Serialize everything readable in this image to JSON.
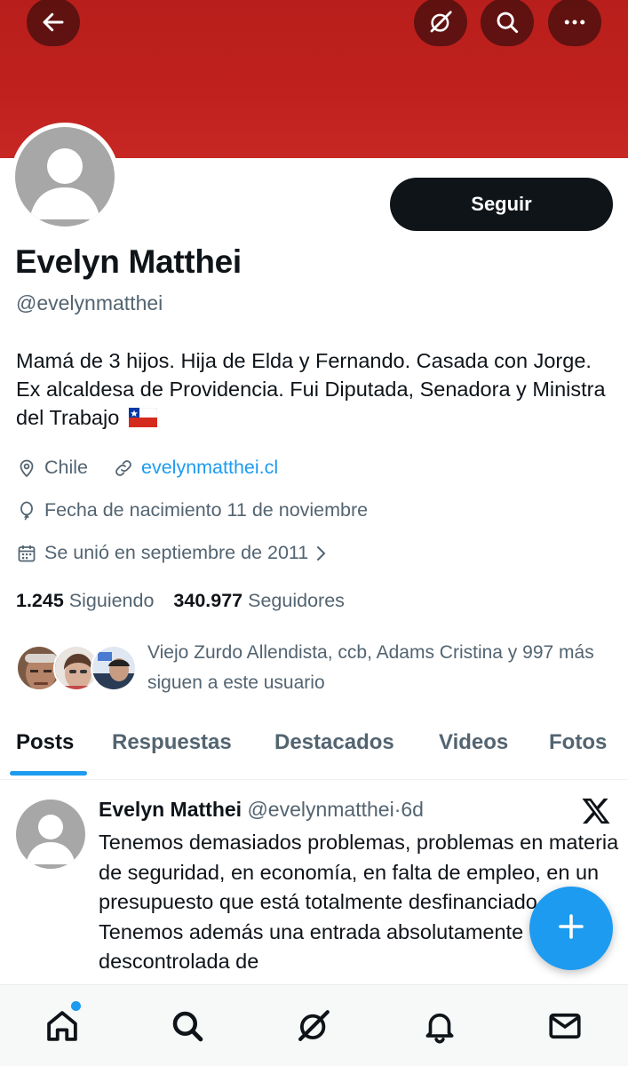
{
  "header": {
    "back_icon": "arrow-left-icon",
    "grok_icon": "grok-icon",
    "search_icon": "search-icon",
    "more_icon": "more-horizontal-icon",
    "banner_color": "#c0201e"
  },
  "profile": {
    "name": "Evelyn Matthei",
    "handle": "@evelynmatthei",
    "follow_label": "Seguir",
    "bio": "Mamá de 3 hijos. Hija de Elda y Fernando. Casada con Jorge. Ex alcaldesa de Providencia. Fui Diputada, Senadora y Ministra del Trabajo",
    "bio_flag_icon": "chile-flag-icon",
    "location": "Chile",
    "website": "evelynmatthei.cl",
    "birthday": "Fecha de nacimiento 11 de noviembre",
    "joined": "Se unió en septiembre de 2011",
    "following_count": "1.245",
    "following_label": "Siguiendo",
    "followers_count": "340.977",
    "followers_label": "Seguidores",
    "known_followers_text": "Viejo Zurdo Allendista, ccb, Adams Cristina y 997 más siguen a este usuario"
  },
  "tabs": [
    {
      "label": "Posts",
      "active": true
    },
    {
      "label": "Respuestas",
      "active": false
    },
    {
      "label": "Destacados",
      "active": false
    },
    {
      "label": "Videos",
      "active": false
    },
    {
      "label": "Fotos",
      "active": false
    }
  ],
  "post": {
    "author": "Evelyn Matthei",
    "handle": "@evelynmatthei",
    "separator": "·",
    "time": "6d",
    "source_icon": "x-logo-icon",
    "text": "Tenemos demasiados problemas, problemas en materia de seguridad, en economía, en falta de empleo, en un presupuesto que está totalmente desfinanciado. Tenemos además una entrada absolutamente descontrolada de"
  },
  "fab": {
    "icon": "plus-icon",
    "color": "#1d9bf0"
  },
  "bottom_nav": {
    "items": [
      "home-icon",
      "search-icon",
      "grok-icon",
      "notifications-icon",
      "messages-icon"
    ],
    "home_has_notification": true,
    "accent": "#1d9bf0"
  }
}
